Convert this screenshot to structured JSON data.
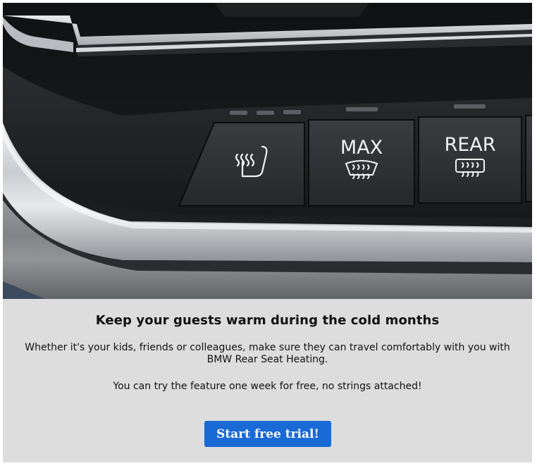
{
  "hero": {
    "buttons": [
      {
        "icon": "seat-heat-icon",
        "label": ""
      },
      {
        "icon": "front-defrost-icon",
        "label": "MAX"
      },
      {
        "icon": "rear-defrost-icon",
        "label": "REAR"
      }
    ]
  },
  "content": {
    "headline": "Keep your guests warm during the cold months",
    "paragraph1": "Whether it's your kids, friends or colleagues, make sure they can travel comfortably with you with BMW Rear Seat Heating.",
    "paragraph2": "You can try the feature one week for free, no strings attached!",
    "cta_label": "Start free trial!"
  },
  "colors": {
    "background": "#dddddd",
    "cta": "#1a6ad6",
    "text": "#111111"
  }
}
